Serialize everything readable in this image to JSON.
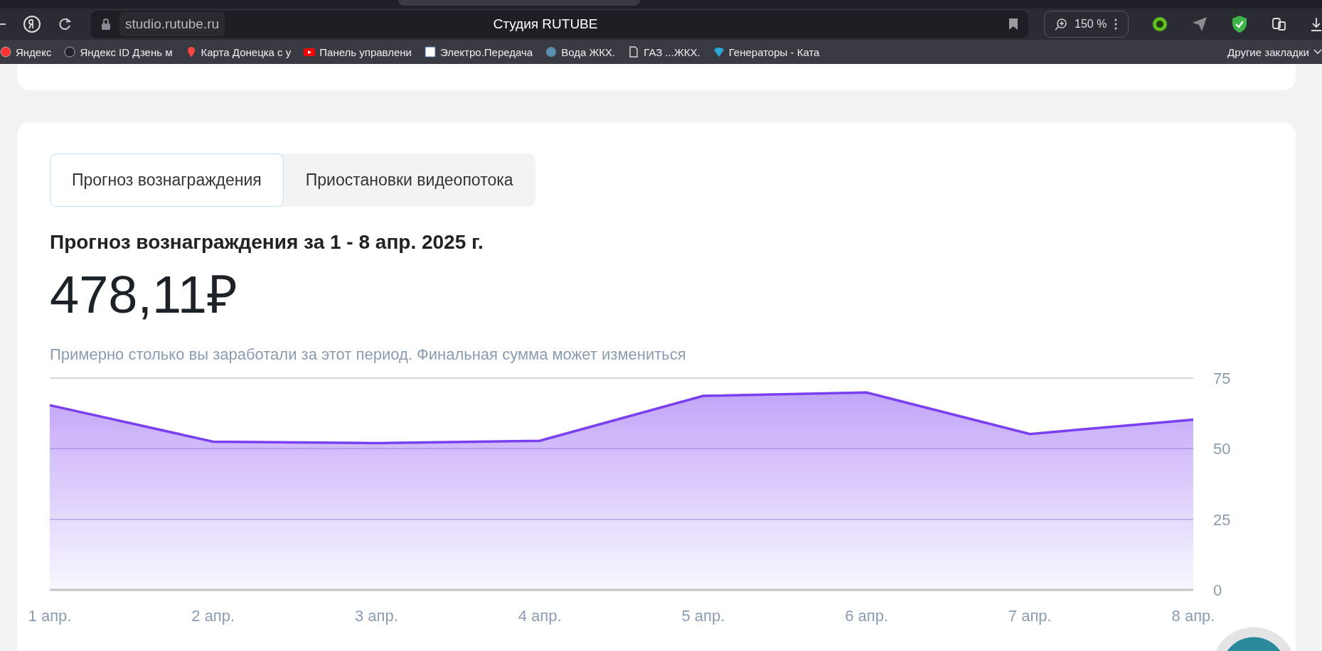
{
  "browser": {
    "tab_title": "Студия RUTUBE",
    "address": "studio.rutube.ru",
    "zoom": "150 %",
    "bookmarks": [
      {
        "label": "Яндекс"
      },
      {
        "label": "Яндекс ID Дзень м"
      },
      {
        "label": "Карта Донецка с у"
      },
      {
        "label": "Панель управлени"
      },
      {
        "label": "Электро.Передача"
      },
      {
        "label": "Вода  ЖКХ."
      },
      {
        "label": "ГАЗ ...ЖКХ."
      },
      {
        "label": "Генераторы - Ката"
      }
    ],
    "other_bookmarks": "Другие закладки"
  },
  "tabs": [
    {
      "label": "Прогноз вознаграждения",
      "selected": true
    },
    {
      "label": "Приостановки видеопотока",
      "selected": false
    }
  ],
  "forecast": {
    "title": "Прогноз вознаграждения за 1 - 8 апр. 2025 г.",
    "amount": "478,11₽",
    "note": "Примерно столько вы заработали за этот период. Финальная сумма может измениться",
    "chart_data": {
      "type": "area",
      "categories": [
        "1 апр.",
        "2 апр.",
        "3 апр.",
        "4 апр.",
        "5 апр.",
        "6 апр.",
        "7 апр.",
        "8 апр."
      ],
      "series": [
        {
          "color": "#7b3ff2",
          "values": [
            65.4,
            52.5,
            52,
            52.8,
            68.7,
            69.9,
            55.2,
            60.3
          ]
        }
      ],
      "ylim": [
        0,
        75
      ],
      "yticks": [
        0,
        25,
        50,
        75
      ]
    }
  }
}
